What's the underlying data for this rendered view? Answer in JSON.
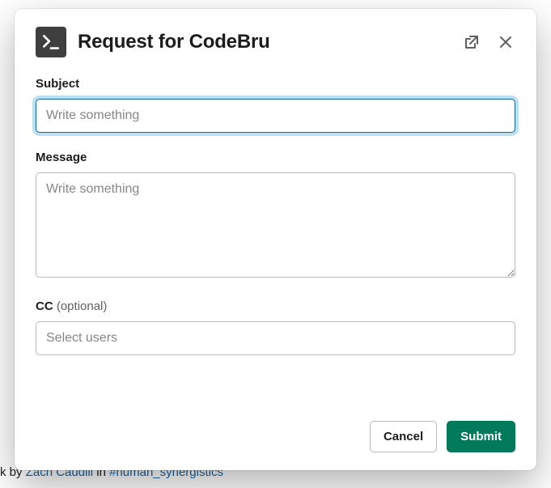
{
  "modal": {
    "title": "Request for CodeBru",
    "subject": {
      "label": "Subject",
      "placeholder": "Write something",
      "value": ""
    },
    "message": {
      "label": "Message",
      "placeholder": "Write something",
      "value": ""
    },
    "cc": {
      "label": "CC",
      "optional": "(optional)",
      "placeholder": "Select users"
    },
    "footer": {
      "cancel": "Cancel",
      "submit": "Submit"
    }
  },
  "background": {
    "line1_prefix": "k by ",
    "line1_user": "Zach Caudill",
    "line1_mid": " in ",
    "line1_channel": "#human_synergistics"
  }
}
